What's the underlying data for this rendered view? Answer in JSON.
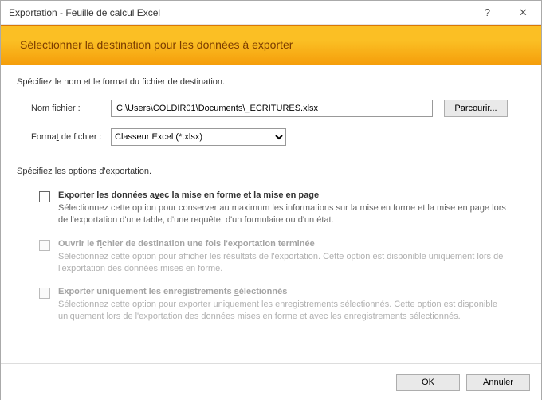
{
  "titlebar": {
    "title": "Exportation - Feuille de calcul Excel",
    "help": "?",
    "close": "✕"
  },
  "banner": {
    "heading": "Sélectionner la destination pour les données à exporter"
  },
  "dest": {
    "section_label": "Spécifiez le nom et le format du fichier de destination.",
    "filename_label": "Nom fichier :",
    "filename_value": "C:\\Users\\COLDIR01\\Documents\\_ECRITURES.xlsx",
    "browse_label": "Parcourir...",
    "format_label": "Format de fichier :",
    "format_value": "Classeur Excel (*.xlsx)"
  },
  "options": {
    "section_label": "Spécifiez les options d'exportation.",
    "opt1": {
      "title": "Exporter les données avec la mise en forme et la mise en page",
      "desc": "Sélectionnez cette option pour conserver au maximum les informations sur la mise en forme et la mise en page lors de l'exportation d'une table, d'une requête, d'un formulaire ou d'un état."
    },
    "opt2": {
      "title": "Ouvrir le fichier de destination une fois l'exportation terminée",
      "desc": "Sélectionnez cette option pour afficher les résultats de l'exportation. Cette option est disponible uniquement lors de l'exportation des données mises en forme."
    },
    "opt3": {
      "title": "Exporter uniquement les enregistrements sélectionnés",
      "desc": "Sélectionnez cette option pour exporter uniquement les enregistrements sélectionnés. Cette option est disponible uniquement lors de l'exportation des données mises en forme et avec les enregistrements sélectionnés."
    }
  },
  "footer": {
    "ok": "OK",
    "cancel": "Annuler"
  }
}
